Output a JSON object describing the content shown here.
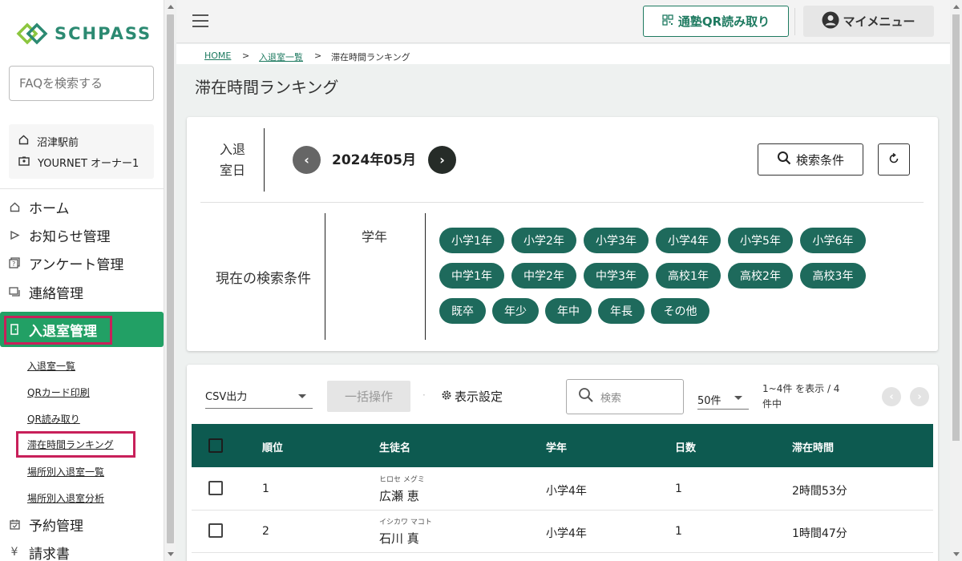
{
  "sidebar": {
    "logo_text": "SCHPASS",
    "faq_placeholder": "FAQを検索する",
    "account": {
      "school": "沼津駅前",
      "user": "YOURNET オーナー1"
    },
    "nav": [
      {
        "label": "ホーム",
        "icon": "home-icon"
      },
      {
        "label": "お知らせ管理",
        "icon": "notice-icon"
      },
      {
        "label": "アンケート管理",
        "icon": "survey-icon"
      },
      {
        "label": "連絡管理",
        "icon": "message-icon"
      },
      {
        "label": "入退室管理",
        "icon": "door-icon",
        "active": true
      },
      {
        "label": "予約管理",
        "icon": "calendar-icon"
      },
      {
        "label": "請求書",
        "icon": "yen-icon"
      }
    ],
    "sub_items": [
      {
        "label": "入退室一覧"
      },
      {
        "label": "QRカード印刷"
      },
      {
        "label": "QR読み取り"
      },
      {
        "label": "滞在時間ランキング",
        "active": true
      },
      {
        "label": "場所別入退室一覧"
      },
      {
        "label": "場所別入退室分析"
      }
    ]
  },
  "topbar": {
    "qr_button": "通塾QR読み取り",
    "mymenu_button": "マイメニュー"
  },
  "breadcrumb": {
    "home": "HOME",
    "sep": ">",
    "parent": "入退室一覧",
    "current": "滞在時間ランキング"
  },
  "page_title": "滞在時間ランキング",
  "filter": {
    "date_label_line1": "入退",
    "date_label_line2": "室日",
    "month": "2024年05月",
    "search_condition_button": "検索条件",
    "current_conditions_label": "現在の検索条件",
    "grade_label": "学年",
    "grades": [
      "小学1年",
      "小学2年",
      "小学3年",
      "小学4年",
      "小学5年",
      "小学6年",
      "中学1年",
      "中学2年",
      "中学3年",
      "高校1年",
      "高校2年",
      "高校3年",
      "既卒",
      "年少",
      "年中",
      "年長",
      "その他"
    ]
  },
  "table_toolbar": {
    "csv_select": "CSV出力",
    "bulk_button": "一括操作",
    "separator": "·",
    "display_settings": "表示設定",
    "search_placeholder": "検索",
    "per_page": "50件",
    "range_line1": "1~4件 を表示 / 4",
    "range_line2": "件中"
  },
  "table": {
    "columns": [
      "順位",
      "生徒名",
      "学年",
      "日数",
      "滞在時間"
    ],
    "rows": [
      {
        "rank": "1",
        "kana": "ヒロセ メグミ",
        "name": "広瀬 恵",
        "grade": "小学4年",
        "days": "1",
        "time": "2時間53分"
      },
      {
        "rank": "2",
        "kana": "イシカワ マコト",
        "name": "石川 真",
        "grade": "小学4年",
        "days": "1",
        "time": "1時間47分"
      }
    ]
  },
  "colors": {
    "brand_green": "#22a065",
    "header_teal": "#0d5a50",
    "chip_teal": "#1e6a5c",
    "highlight_red": "#c8205a"
  }
}
